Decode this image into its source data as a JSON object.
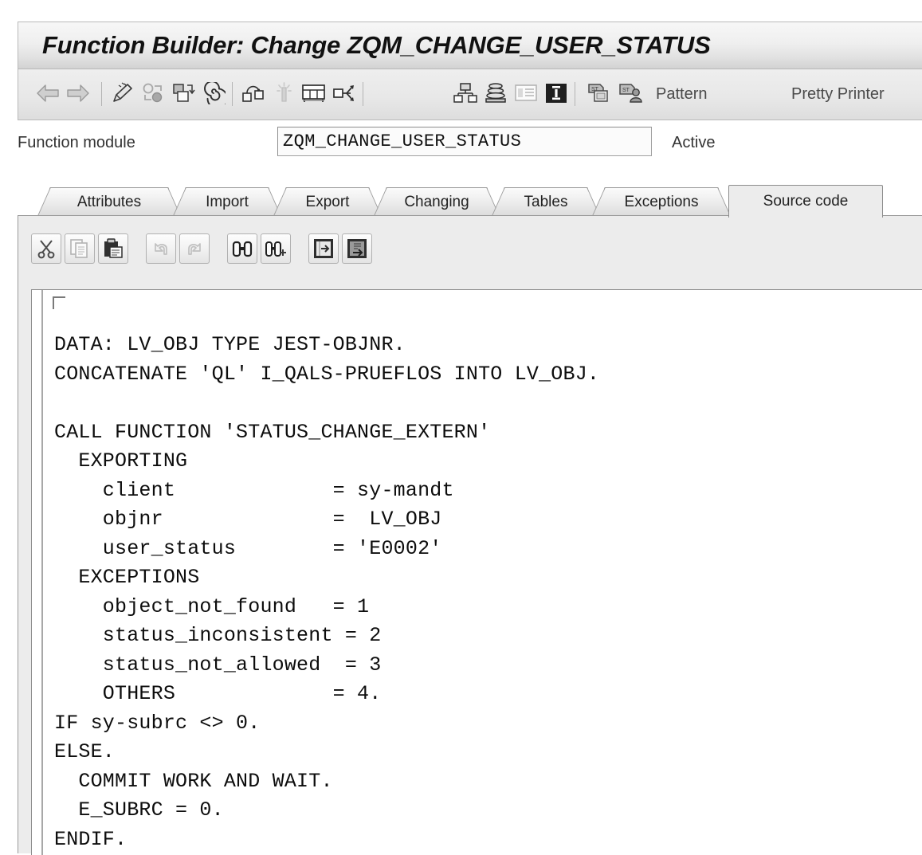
{
  "window": {
    "title": "Function Builder: Change ZQM_CHANGE_USER_STATUS"
  },
  "toolbar": {
    "items": [
      {
        "name": "back-icon",
        "icon": "arrow-left",
        "label": ""
      },
      {
        "name": "forward-icon",
        "icon": "arrow-right",
        "label": ""
      },
      {
        "name": "edit-pencil-icon",
        "icon": "pencil",
        "label": ""
      },
      {
        "name": "display-change-icon",
        "icon": "toggle-balls",
        "label": ""
      },
      {
        "name": "other-object-icon",
        "icon": "squares-down",
        "label": ""
      },
      {
        "name": "spiral-icon",
        "icon": "spiral",
        "label": ""
      },
      {
        "name": "where-used-list-icon",
        "icon": "where-used",
        "label": ""
      },
      {
        "name": "magic-wand-icon",
        "icon": "wand",
        "label": ""
      },
      {
        "name": "table-display-icon",
        "icon": "table",
        "label": ""
      },
      {
        "name": "call-hierarchy-icon",
        "icon": "call-arrows",
        "label": ""
      },
      {
        "name": "hierarchy-icon",
        "icon": "org-tree",
        "label": ""
      },
      {
        "name": "stack-icon",
        "icon": "stack",
        "label": ""
      },
      {
        "name": "documentation-icon",
        "icon": "doc-list",
        "label": ""
      },
      {
        "name": "info-icon",
        "icon": "info-box",
        "label": ""
      },
      {
        "name": "copy-st-icon",
        "icon": "st-copy",
        "label": ""
      },
      {
        "name": "copy-st-user-icon",
        "icon": "st-user",
        "label": ""
      }
    ],
    "pattern_label": "Pattern",
    "pretty_printer_label": "Pretty Printer"
  },
  "function_module": {
    "label": "Function module",
    "value": "ZQM_CHANGE_USER_STATUS",
    "placeholder": "",
    "status": "Active"
  },
  "tabs": [
    {
      "label": "Attributes",
      "active": false
    },
    {
      "label": "Import",
      "active": false
    },
    {
      "label": "Export",
      "active": false
    },
    {
      "label": "Changing",
      "active": false
    },
    {
      "label": "Tables",
      "active": false
    },
    {
      "label": "Exceptions",
      "active": false
    },
    {
      "label": "Source code",
      "active": true
    }
  ],
  "editor_toolbar": {
    "buttons": [
      {
        "name": "cut-icon",
        "icon": "scissors",
        "enabled": true
      },
      {
        "name": "copy-icon",
        "icon": "copy-pages",
        "enabled": false
      },
      {
        "name": "paste-icon",
        "icon": "clipboard",
        "enabled": true
      },
      {
        "name": "undo-icon",
        "icon": "undo-arrow",
        "enabled": false
      },
      {
        "name": "redo-icon",
        "icon": "redo-arrow",
        "enabled": false
      },
      {
        "name": "find-icon",
        "icon": "binoculars",
        "enabled": true
      },
      {
        "name": "find-next-icon",
        "icon": "binoculars-plus",
        "enabled": true
      },
      {
        "name": "insert-from-file-icon",
        "icon": "import-doc",
        "enabled": true
      },
      {
        "name": "save-to-file-icon",
        "icon": "export-doc",
        "enabled": true
      }
    ]
  },
  "source_code": {
    "text": "DATA: LV_OBJ TYPE JEST-OBJNR.\nCONCATENATE 'QL' I_QALS-PRUEFLOS INTO LV_OBJ.\n\nCALL FUNCTION 'STATUS_CHANGE_EXTERN'\n  EXPORTING\n    client             = sy-mandt\n    objnr              =  LV_OBJ\n    user_status        = 'E0002'\n  EXCEPTIONS\n    object_not_found   = 1\n    status_inconsistent = 2\n    status_not_allowed  = 3\n    OTHERS             = 4.\nIF sy-subrc <> 0.\nELSE.\n  COMMIT WORK AND WAIT.\n  E_SUBRC = 0.\nENDIF.",
    "lines": [
      "DATA: LV_OBJ TYPE JEST-OBJNR.",
      "CONCATENATE 'QL' I_QALS-PRUEFLOS INTO LV_OBJ.",
      "",
      "CALL FUNCTION 'STATUS_CHANGE_EXTERN'",
      "  EXPORTING",
      "    client             = sy-mandt",
      "    objnr              =  LV_OBJ",
      "    user_status        = 'E0002'",
      "  EXCEPTIONS",
      "    object_not_found   = 1",
      "    status_inconsistent = 2",
      "    status_not_allowed  = 3",
      "    OTHERS             = 4.",
      "IF sy-subrc <> 0.",
      "ELSE.",
      "  COMMIT WORK AND WAIT.",
      "  E_SUBRC = 0.",
      "ENDIF."
    ]
  },
  "colors": {
    "panel_bg": "#ececec",
    "toolbar_bg": "#e8e8e8",
    "border": "#9b9b9b",
    "text": "#222222",
    "code_text": "#0d0d0d",
    "code_bg": "#ffffff"
  }
}
